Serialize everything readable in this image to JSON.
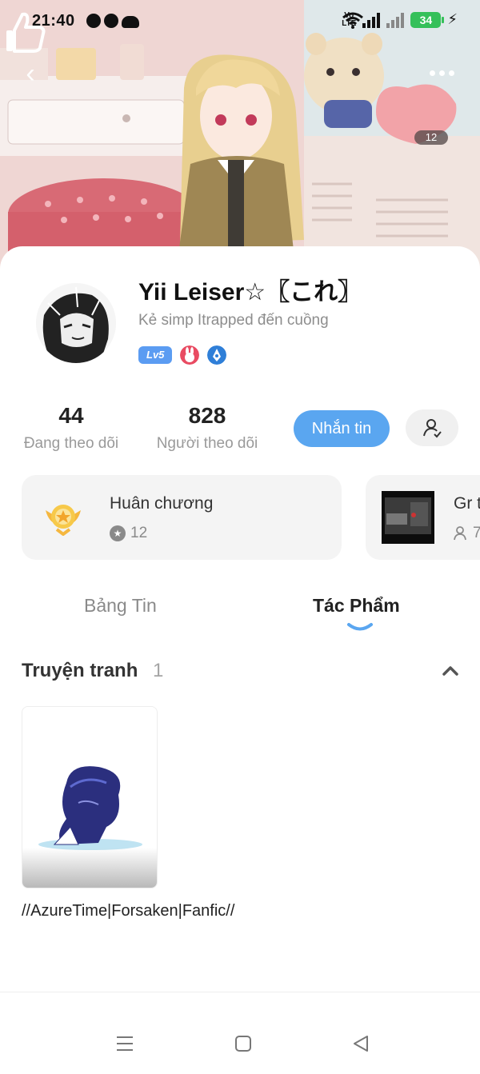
{
  "status_bar": {
    "time": "21:40",
    "volte": "Vo\nLTE",
    "battery": "34"
  },
  "header": {
    "like_count": "12"
  },
  "profile": {
    "username": "Yii Leiser☆〖これ〗",
    "bio": "Kẻ simp Itrapped đến cuồng",
    "level": "Lv5",
    "following_count": "44",
    "following_label": "Đang theo dõi",
    "followers_count": "828",
    "followers_label": "Người theo dõi",
    "message_label": "Nhắn tin"
  },
  "cards": {
    "medals": {
      "title": "Huân chương",
      "count": "12"
    },
    "group": {
      "title": "Gr t",
      "members": "7"
    }
  },
  "tabs": [
    {
      "label": "Bảng Tin",
      "active": false
    },
    {
      "label": "Tác Phẩm",
      "active": true
    }
  ],
  "section": {
    "title": "Truyện tranh",
    "count": "1"
  },
  "comics": [
    {
      "title": "//AzureTime|Forsaken|Fanfic//"
    }
  ],
  "colors": {
    "accent": "#5aa6f0",
    "level_badge": "#5b9cf2",
    "battery": "#35c05a"
  }
}
